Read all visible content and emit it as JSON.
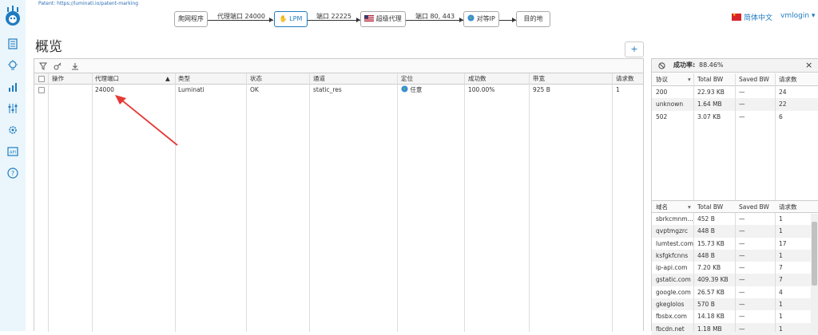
{
  "patent": "Patent: https://luminati.io/patent-marking",
  "flow": {
    "node_browser": "爬网程序",
    "edge1": "代理端口 24000",
    "node_lpm": "LPM",
    "edge2": "端口 22225",
    "node_super": "超级代理",
    "edge3": "端口 80, 443",
    "node_peer": "对等IP",
    "node_dest": "目的地"
  },
  "header": {
    "language": "简体中文",
    "user": "vmlogin ▾"
  },
  "page_title": "概览",
  "plus_label": "+",
  "ports_table": {
    "columns": [
      "操作",
      "代理端口",
      "类型",
      "状态",
      "通道",
      "定位",
      "成功数",
      "带宽",
      "请求数"
    ],
    "sort_indicator": "▲",
    "rows": [
      {
        "port": "24000",
        "type": "Luminati",
        "status": "OK",
        "channel": "static_res",
        "location": "任意",
        "success": "100.00%",
        "bandwidth": "925 B",
        "requests": "1"
      }
    ]
  },
  "success_panel": {
    "label": "成功率:",
    "value": "88.46%",
    "close": "×"
  },
  "protocol_table": {
    "columns": [
      "协议",
      "Total BW",
      "Saved BW",
      "请求数"
    ],
    "rows": [
      {
        "key": "200",
        "total": "22.93 KB",
        "saved": "—",
        "req": "24"
      },
      {
        "key": "unknown",
        "total": "1.64 MB",
        "saved": "—",
        "req": "22"
      },
      {
        "key": "502",
        "total": "3.07 KB",
        "saved": "—",
        "req": "6"
      }
    ]
  },
  "domain_table": {
    "columns": [
      "域名",
      "Total BW",
      "Saved BW",
      "请求数"
    ],
    "rows": [
      {
        "key": "sbrkcmnm...",
        "total": "452 B",
        "saved": "—",
        "req": "1"
      },
      {
        "key": "qvptmgzrc",
        "total": "448 B",
        "saved": "—",
        "req": "1"
      },
      {
        "key": "lumtest.com",
        "total": "15.73 KB",
        "saved": "—",
        "req": "17"
      },
      {
        "key": "ksfgkfcnns",
        "total": "448 B",
        "saved": "—",
        "req": "1"
      },
      {
        "key": "ip-api.com",
        "total": "7.20 KB",
        "saved": "—",
        "req": "7"
      },
      {
        "key": "gstatic.com",
        "total": "409.39 KB",
        "saved": "—",
        "req": "7"
      },
      {
        "key": "google.com",
        "total": "26.57 KB",
        "saved": "—",
        "req": "4"
      },
      {
        "key": "gkeglolos",
        "total": "570 B",
        "saved": "—",
        "req": "1"
      },
      {
        "key": "fbsbx.com",
        "total": "14.18 KB",
        "saved": "—",
        "req": "1"
      },
      {
        "key": "fbcdn.net",
        "total": "1.18 MB",
        "saved": "—",
        "req": "1"
      }
    ]
  },
  "colors": {
    "accent": "#1f7bc1",
    "sidebar": "#eaf6fb",
    "annotation": "#e53935"
  }
}
